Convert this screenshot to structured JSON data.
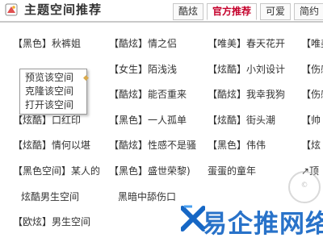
{
  "header": {
    "title": "主题空间推荐",
    "tabs": [
      {
        "label": "酷炫",
        "active": false
      },
      {
        "label": "官方推荐",
        "active": true
      },
      {
        "label": "可爱",
        "active": false
      },
      {
        "label": "简约",
        "active": false
      }
    ]
  },
  "rows": [
    [
      "【黑色】秋裤姐",
      "【酷炫】情之侣",
      "【唯美】春天花开",
      "【唯美"
    ],
    [
      "",
      "【女生】陌浅浅",
      "【炫酷】小刘设计",
      "【伤感"
    ],
    [
      "",
      "【酷炫】能否重来",
      "【酷炫】我幸我狗",
      "【伤感"
    ],
    [
      "【炫酷】口红印",
      "【黑色】一人孤单",
      "【炫酷】街头潮",
      "【帅"
    ],
    [
      "【炫酷】情何以堪",
      "【酷炫】性感不是骚",
      "【黑色】伟伟",
      "【炫"
    ],
    [
      "【黑色空间】某人的",
      "【黑色】盛世荣黎)",
      "蛋蛋的童年",
      "↗顶"
    ],
    [
      "炫酷男生空间",
      "黑暗中舔伤口",
      "",
      ""
    ],
    [
      "【欧炫】男生空间",
      "",
      "",
      ""
    ]
  ],
  "context_menu": {
    "items": [
      "预览该空间",
      "克隆该空间",
      "打开该空间"
    ]
  },
  "watermark": {
    "text": "易企推网络"
  },
  "colors": {
    "accent": "#c4002b",
    "watermark": "#1667c5",
    "border": "#c9c9c9"
  }
}
